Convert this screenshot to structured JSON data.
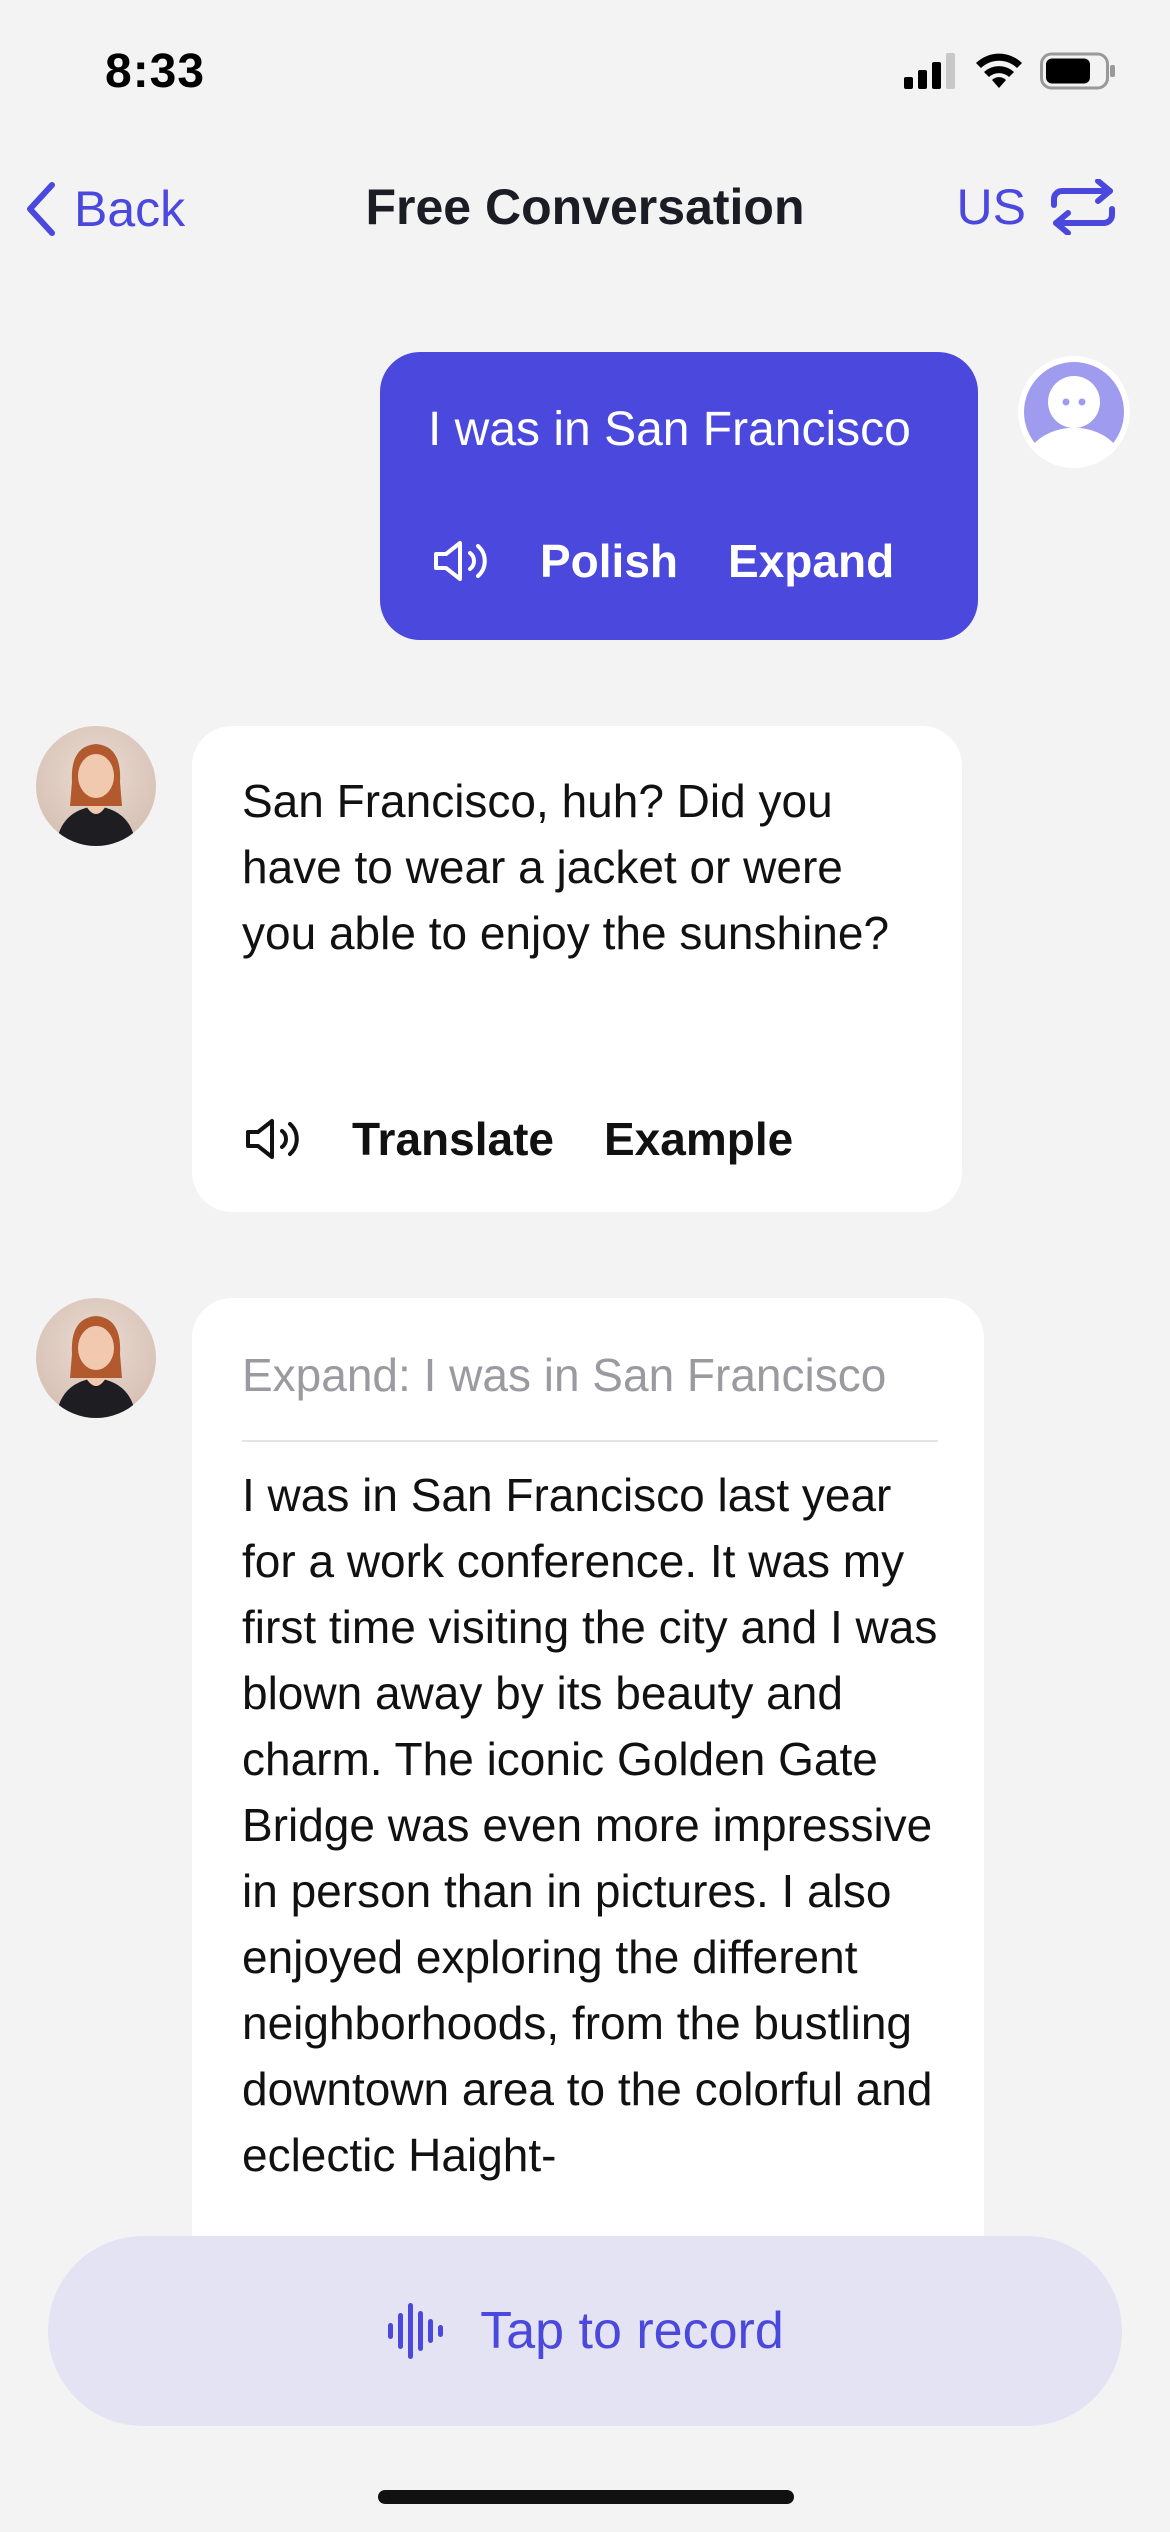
{
  "status_bar": {
    "time": "8:33"
  },
  "nav": {
    "back_label": "Back",
    "title": "Free Conversation",
    "language": "US"
  },
  "user_message": {
    "text": "I was in San Francisco",
    "actions": {
      "polish": "Polish",
      "expand": "Expand"
    }
  },
  "bot_message": {
    "text": "San Francisco, huh? Did you have to wear a jacket or were you able to enjoy the sunshine?",
    "actions": {
      "translate": "Translate",
      "example": "Example"
    }
  },
  "expand_card": {
    "heading": "Expand: I was in San Francisco",
    "text": "I was in San Francisco last year for a work conference. It was my first time visiting the city and I was blown away by its beauty and charm. The iconic Golden Gate Bridge was even more impressive in person than in pictures. I also enjoyed exploring the different neighborhoods, from the bustling downtown area to the colorful and eclectic Haight-"
  },
  "record_button": {
    "label": "Tap to record"
  },
  "colors": {
    "accent": "#4b48dd",
    "background": "#f3f3f4",
    "record_bg": "#e4e3f3"
  },
  "icons": [
    "back-chevron-icon",
    "swap-icon",
    "speaker-icon",
    "waveform-icon",
    "signal-icon",
    "wifi-icon",
    "battery-icon"
  ]
}
